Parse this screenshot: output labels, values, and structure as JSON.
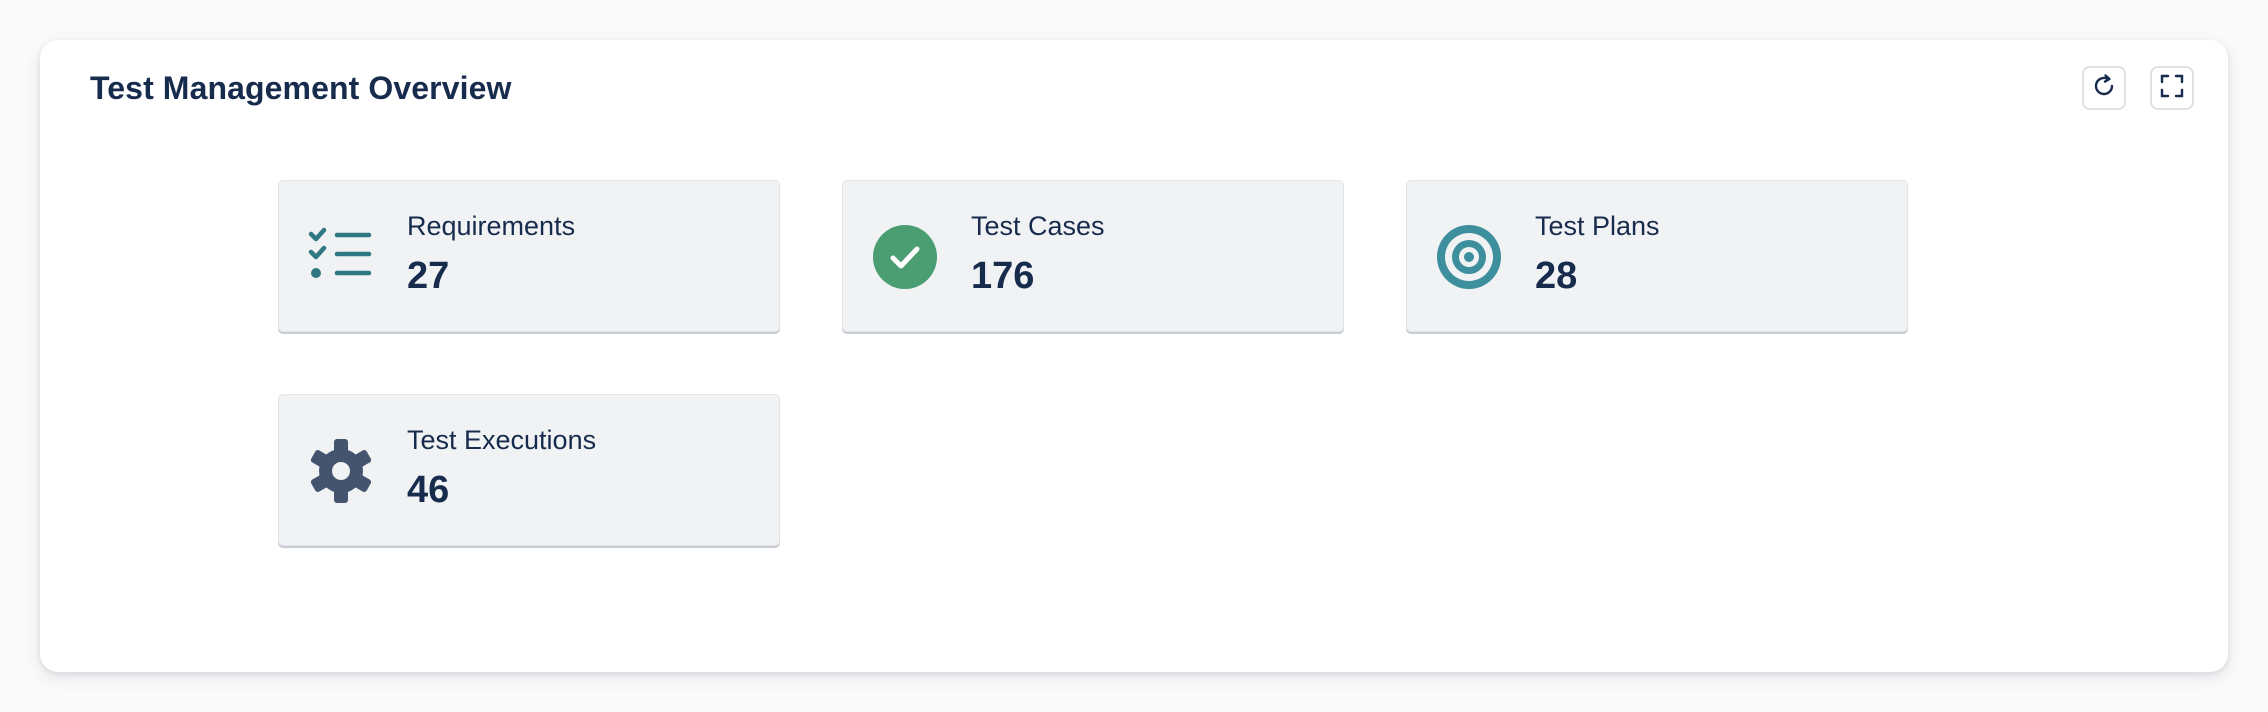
{
  "panel": {
    "title": "Test Management Overview",
    "toolbar": [
      {
        "icon": "refresh-icon"
      },
      {
        "icon": "fullscreen-icon"
      }
    ]
  },
  "cards": [
    {
      "label": "Requirements",
      "value": "27",
      "icon": "checklist-icon",
      "color": "#2f7783"
    },
    {
      "label": "Test Cases",
      "value": "176",
      "icon": "check-circle-icon",
      "color": "#4a9e72"
    },
    {
      "label": "Test Plans",
      "value": "28",
      "icon": "target-icon",
      "color": "#3d8f9e"
    },
    {
      "label": "Test Executions",
      "value": "46",
      "icon": "gear-icon",
      "color": "#44546f"
    }
  ]
}
